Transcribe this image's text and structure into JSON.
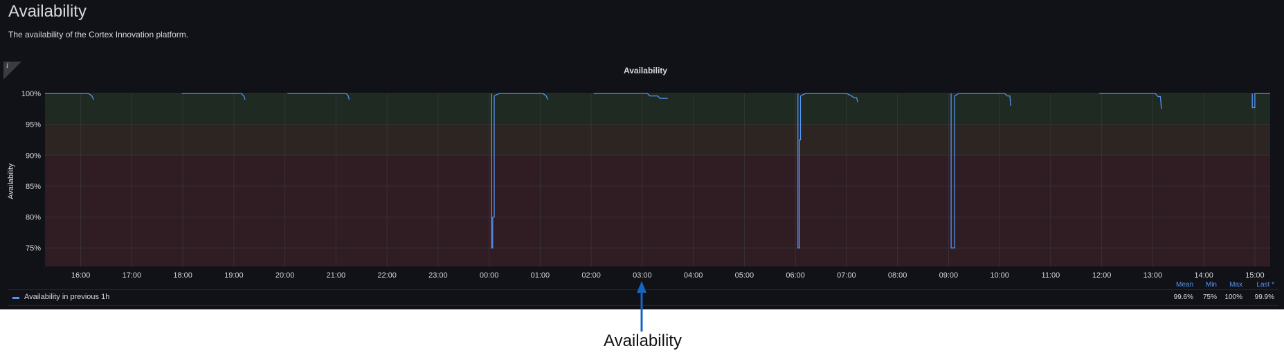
{
  "dashboard": {
    "title": "Availability",
    "description": "The availability of the Cortex Innovation platform.",
    "info_icon": "info-icon"
  },
  "panel": {
    "title": "Availability",
    "legend": {
      "series_name": "Availability in previous 1h",
      "series_color": "#5794f2",
      "stats": [
        {
          "label": "Mean",
          "value": "99.6%"
        },
        {
          "label": "Min",
          "value": "75%"
        },
        {
          "label": "Max",
          "value": "100%"
        },
        {
          "label": "Last *",
          "value": "99.9%"
        }
      ]
    }
  },
  "annotation": {
    "caption": "Availability",
    "arrow_icon": "arrow-up-icon",
    "arrow_color": "#1565c0"
  },
  "chart_data": {
    "type": "line",
    "title": "Availability",
    "ylabel": "Availability",
    "xlabel": "",
    "y_ticks": [
      "100%",
      "95%",
      "90%",
      "85%",
      "80%",
      "75%"
    ],
    "y_tick_values": [
      100,
      95,
      90,
      85,
      80,
      75
    ],
    "ylim": [
      72,
      100
    ],
    "x_ticks": [
      "16:00",
      "17:00",
      "18:00",
      "19:00",
      "20:00",
      "21:00",
      "22:00",
      "23:00",
      "00:00",
      "01:00",
      "02:00",
      "03:00",
      "04:00",
      "05:00",
      "06:00",
      "07:00",
      "08:00",
      "09:00",
      "10:00",
      "11:00",
      "12:00",
      "13:00",
      "14:00",
      "15:00"
    ],
    "x_range_hours": [
      -0.7,
      23.3
    ],
    "grid": true,
    "threshold_bands": [
      {
        "from": 95,
        "to": 100,
        "color": "#1f2a22"
      },
      {
        "from": 90,
        "to": 95,
        "color": "#2c2521"
      },
      {
        "from": 72,
        "to": 90,
        "color": "#2f1d23"
      }
    ],
    "series": [
      {
        "name": "Availability in previous 1h",
        "color": "#5794f2",
        "segments": [
          [
            [
              -0.7,
              100
            ],
            [
              0.15,
              100
            ],
            [
              0.22,
              99.6
            ],
            [
              0.25,
              99.0
            ]
          ],
          [
            [
              1.98,
              100
            ],
            [
              3.15,
              100
            ],
            [
              3.2,
              99.5
            ],
            [
              3.22,
              99.0
            ]
          ],
          [
            [
              4.05,
              100
            ],
            [
              5.2,
              100
            ],
            [
              5.24,
              99.6
            ],
            [
              5.26,
              99.0
            ]
          ],
          [
            [
              -0.05,
              100
            ],
            [
              -0.05,
              100
            ]
          ],
          [
            [
              8.05,
              100
            ],
            [
              8.05,
              75
            ],
            [
              8.07,
              75
            ],
            [
              8.07,
              80
            ],
            [
              8.1,
              80
            ],
            [
              8.1,
              99.6
            ],
            [
              8.2,
              100
            ],
            [
              9.05,
              100
            ],
            [
              9.12,
              99.6
            ],
            [
              9.15,
              99.0
            ]
          ],
          [
            [
              10.05,
              100
            ],
            [
              11.1,
              100
            ],
            [
              11.15,
              99.6
            ],
            [
              11.3,
              99.6
            ],
            [
              11.35,
              99.2
            ],
            [
              11.5,
              99.2
            ]
          ],
          [
            [
              14.05,
              100
            ],
            [
              14.05,
              75
            ],
            [
              14.08,
              75
            ],
            [
              14.08,
              92.5
            ],
            [
              14.1,
              92.5
            ],
            [
              14.1,
              99.6
            ],
            [
              14.2,
              100
            ],
            [
              15.0,
              100
            ],
            [
              15.1,
              99.6
            ],
            [
              15.15,
              99.3
            ],
            [
              15.2,
              99.3
            ],
            [
              15.22,
              98.6
            ]
          ],
          [
            [
              17.05,
              100
            ],
            [
              17.05,
              75
            ],
            [
              17.12,
              75
            ],
            [
              17.12,
              99.6
            ],
            [
              17.2,
              100
            ],
            [
              18.1,
              100
            ],
            [
              18.15,
              99.6
            ],
            [
              18.2,
              99.6
            ],
            [
              18.22,
              98.0
            ]
          ],
          [
            [
              19.95,
              100
            ],
            [
              21.05,
              100
            ],
            [
              21.1,
              99.5
            ],
            [
              21.15,
              99.5
            ],
            [
              21.17,
              97.5
            ]
          ],
          [
            [
              22.95,
              100
            ],
            [
              22.95,
              97.7
            ],
            [
              23.0,
              97.7
            ],
            [
              23.0,
              100
            ],
            [
              23.3,
              100
            ]
          ]
        ]
      }
    ]
  }
}
